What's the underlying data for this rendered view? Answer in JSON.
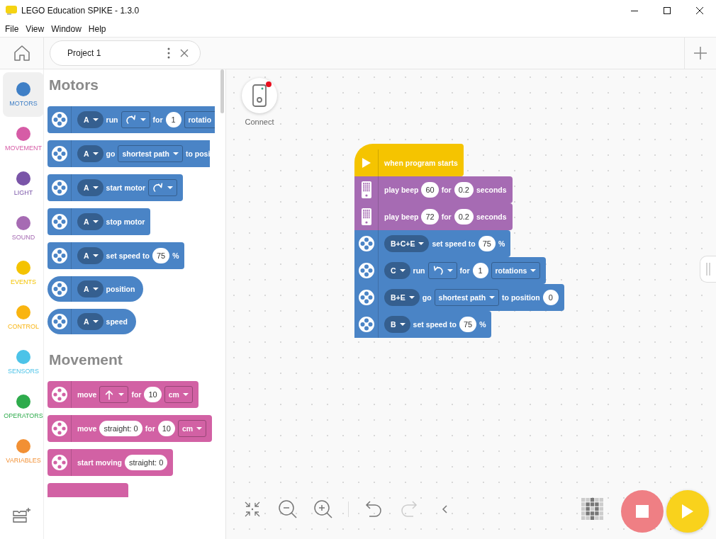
{
  "window": {
    "title": "LEGO Education SPIKE - 1.3.0"
  },
  "menu": [
    "File",
    "View",
    "Window",
    "Help"
  ],
  "tabs": [
    {
      "label": "Project 1",
      "selected": true
    }
  ],
  "categories": [
    {
      "label": "MOTORS",
      "color": "#3f7fc6",
      "selected": true
    },
    {
      "label": "MOVEMENT",
      "color": "#d65ca6",
      "selected": false
    },
    {
      "label": "LIGHT",
      "color": "#7a55a8",
      "selected": false
    },
    {
      "label": "SOUND",
      "color": "#a66bb3",
      "selected": false
    },
    {
      "label": "EVENTS",
      "color": "#f4c300",
      "selected": false
    },
    {
      "label": "CONTROL",
      "color": "#f9b410",
      "selected": false
    },
    {
      "label": "SENSORS",
      "color": "#4cc3e8",
      "selected": false
    },
    {
      "label": "OPERATORS",
      "color": "#2eab4c",
      "selected": false
    },
    {
      "label": "VARIABLES",
      "color": "#f29034",
      "selected": false
    }
  ],
  "palette": [
    {
      "title": "Motors",
      "blocks": [
        {
          "kind": "motor",
          "color": "#4a84c6",
          "parts": [
            {
              "kind": "drop",
              "text": "A"
            },
            {
              "kind": "text",
              "text": "run"
            },
            {
              "kind": "cw-drop"
            },
            {
              "kind": "text",
              "text": "for"
            },
            {
              "kind": "num",
              "text": "1"
            },
            {
              "kind": "box",
              "text": "rotatio"
            }
          ]
        },
        {
          "kind": "motor",
          "color": "#4a84c6",
          "parts": [
            {
              "kind": "drop",
              "text": "A"
            },
            {
              "kind": "text",
              "text": "go"
            },
            {
              "kind": "dropbox",
              "text": "shortest path"
            },
            {
              "kind": "text",
              "text": "to posi"
            }
          ]
        },
        {
          "kind": "motor",
          "color": "#4a84c6",
          "parts": [
            {
              "kind": "drop",
              "text": "A"
            },
            {
              "kind": "text",
              "text": "start motor"
            },
            {
              "kind": "cw-drop"
            }
          ]
        },
        {
          "kind": "motor",
          "color": "#4a84c6",
          "parts": [
            {
              "kind": "drop",
              "text": "A"
            },
            {
              "kind": "text",
              "text": "stop motor"
            }
          ]
        },
        {
          "kind": "motor",
          "color": "#4a84c6",
          "parts": [
            {
              "kind": "drop",
              "text": "A"
            },
            {
              "kind": "text",
              "text": "set speed to"
            },
            {
              "kind": "num",
              "text": "75"
            },
            {
              "kind": "text",
              "text": "%"
            }
          ]
        },
        {
          "kind": "reporter",
          "color": "#4a84c6",
          "parts": [
            {
              "kind": "drop",
              "text": "A"
            },
            {
              "kind": "text",
              "text": "position"
            }
          ]
        },
        {
          "kind": "reporter",
          "color": "#4a84c6",
          "parts": [
            {
              "kind": "drop",
              "text": "A"
            },
            {
              "kind": "text",
              "text": "speed"
            }
          ]
        }
      ]
    },
    {
      "title": "Movement",
      "blocks": [
        {
          "kind": "movement",
          "color": "#d261a4",
          "parts": [
            {
              "kind": "text",
              "text": "move"
            },
            {
              "kind": "up-drop"
            },
            {
              "kind": "text",
              "text": "for"
            },
            {
              "kind": "num",
              "text": "10"
            },
            {
              "kind": "dropbox",
              "text": "cm"
            }
          ]
        },
        {
          "kind": "movement",
          "color": "#d261a4",
          "parts": [
            {
              "kind": "text",
              "text": "move"
            },
            {
              "kind": "num",
              "text": "straight: 0"
            },
            {
              "kind": "text",
              "text": "for"
            },
            {
              "kind": "num",
              "text": "10"
            },
            {
              "kind": "dropbox",
              "text": "cm"
            }
          ]
        },
        {
          "kind": "movement",
          "color": "#d261a4",
          "parts": [
            {
              "kind": "text",
              "text": "start moving"
            },
            {
              "kind": "num",
              "text": "straight: 0"
            }
          ]
        },
        {
          "kind": "stub",
          "color": "#d261a4"
        }
      ]
    }
  ],
  "connect": {
    "label": "Connect",
    "alert": true
  },
  "program": [
    {
      "kind": "hat",
      "color": "#f5c400",
      "parts": [
        {
          "kind": "text",
          "text": "when program starts"
        }
      ]
    },
    {
      "kind": "sound",
      "color": "#a66bb3",
      "parts": [
        {
          "kind": "text",
          "text": "play beep"
        },
        {
          "kind": "num",
          "text": "60"
        },
        {
          "kind": "text",
          "text": "for"
        },
        {
          "kind": "num",
          "text": "0.2"
        },
        {
          "kind": "text",
          "text": "seconds"
        }
      ]
    },
    {
      "kind": "sound",
      "color": "#a66bb3",
      "parts": [
        {
          "kind": "text",
          "text": "play beep"
        },
        {
          "kind": "num",
          "text": "72"
        },
        {
          "kind": "text",
          "text": "for"
        },
        {
          "kind": "num",
          "text": "0.2"
        },
        {
          "kind": "text",
          "text": "seconds"
        }
      ]
    },
    {
      "kind": "motor",
      "color": "#4a84c6",
      "parts": [
        {
          "kind": "drop",
          "text": "B+C+E"
        },
        {
          "kind": "text",
          "text": "set speed to"
        },
        {
          "kind": "num",
          "text": "75"
        },
        {
          "kind": "text",
          "text": "%"
        }
      ]
    },
    {
      "kind": "motor",
      "color": "#4a84c6",
      "parts": [
        {
          "kind": "drop",
          "text": "C"
        },
        {
          "kind": "text",
          "text": "run"
        },
        {
          "kind": "ccw-drop"
        },
        {
          "kind": "text",
          "text": "for"
        },
        {
          "kind": "num",
          "text": "1"
        },
        {
          "kind": "dropbox",
          "text": "rotations"
        }
      ]
    },
    {
      "kind": "motor",
      "color": "#4a84c6",
      "parts": [
        {
          "kind": "drop",
          "text": "B+E"
        },
        {
          "kind": "text",
          "text": "go"
        },
        {
          "kind": "dropbox",
          "text": "shortest path"
        },
        {
          "kind": "text",
          "text": "to position"
        },
        {
          "kind": "num",
          "text": "0"
        }
      ]
    },
    {
      "kind": "motor",
      "color": "#4a84c6",
      "parts": [
        {
          "kind": "drop",
          "text": "B"
        },
        {
          "kind": "text",
          "text": "set speed to"
        },
        {
          "kind": "num",
          "text": "75"
        },
        {
          "kind": "text",
          "text": "%"
        }
      ]
    }
  ]
}
